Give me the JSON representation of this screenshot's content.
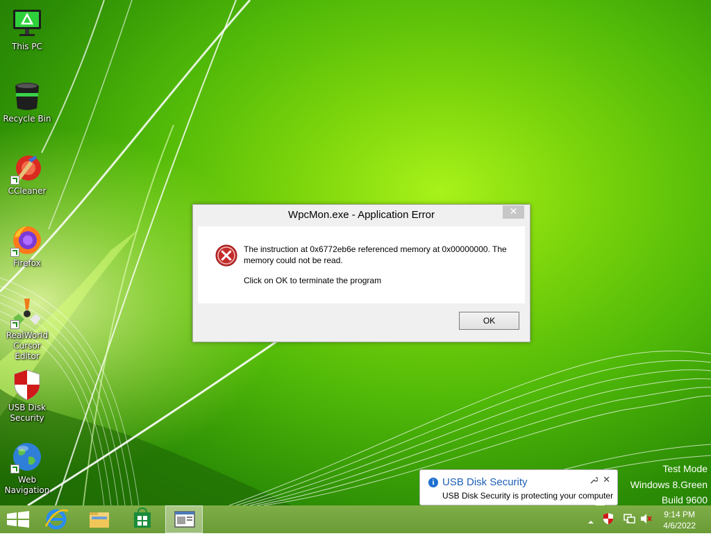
{
  "desktop": {
    "icons": [
      {
        "label": "This PC",
        "icon": "computer-icon"
      },
      {
        "label": "Recycle Bin",
        "icon": "recycle-bin-icon"
      },
      {
        "label": "CCleaner",
        "icon": "ccleaner-icon"
      },
      {
        "label": "Firefox",
        "icon": "firefox-icon"
      },
      {
        "label": "RealWorld Cursor Editor",
        "icon": "cursor-editor-icon"
      },
      {
        "label": "USB Disk Security",
        "icon": "usb-disk-security-icon"
      },
      {
        "label": "Web Navigation",
        "icon": "globe-icon"
      }
    ]
  },
  "dialog": {
    "title": "WpcMon.exe - Application Error",
    "close_label": "✕",
    "message": "The instruction at 0x6772eb6e referenced memory at 0x00000000. The memory could not be read.",
    "message2": "Click on OK to terminate the program",
    "ok_label": "OK",
    "icon": "error-icon"
  },
  "watermark": {
    "line1": "Test Mode",
    "line2": "Windows 8.Green",
    "line3": "Build 9600"
  },
  "notification": {
    "title": "USB Disk Security",
    "text": "USB Disk Security is protecting your computer",
    "close_label": "✕",
    "info_label": "i"
  },
  "taskbar": {
    "start_icon": "windows-start-icon",
    "pinned": [
      "internet-explorer-icon",
      "file-explorer-icon",
      "store-icon",
      "app-window-icon"
    ],
    "tray_icons": [
      "show-hidden-icons-chevron",
      "usb-disk-security-tray-icon",
      "network-icon",
      "volume-muted-icon"
    ]
  },
  "clock": {
    "time": "9:14 PM",
    "date": "4/6/2022"
  },
  "colors": {
    "accent_green": "#7ed60c",
    "taskbar": "#74a43f",
    "error_red": "#c42b2b",
    "info_blue": "#1e6fd1"
  }
}
